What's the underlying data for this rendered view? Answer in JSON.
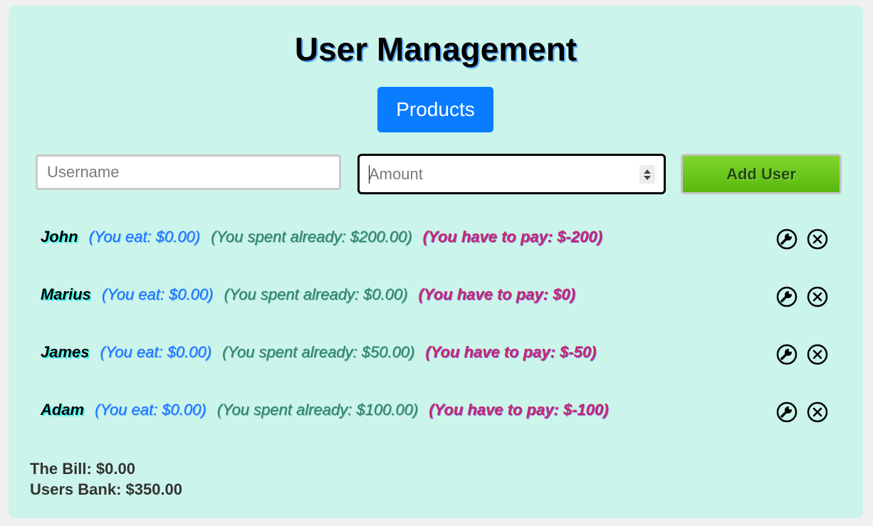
{
  "header": {
    "title": "User Management",
    "products_label": "Products"
  },
  "form": {
    "username_placeholder": "Username",
    "username_value": "",
    "amount_placeholder": "Amount",
    "amount_value": "",
    "add_label": "Add User"
  },
  "users": [
    {
      "name": "John",
      "eat": "(You eat: $0.00)",
      "spent": "(You spent already: $200.00)",
      "pay": "(You have to pay: $-200)"
    },
    {
      "name": "Marius",
      "eat": "(You eat: $0.00)",
      "spent": "(You spent already: $0.00)",
      "pay": "(You have to pay: $0)"
    },
    {
      "name": "James",
      "eat": "(You eat: $0.00)",
      "spent": "(You spent already: $50.00)",
      "pay": "(You have to pay: $-50)"
    },
    {
      "name": "Adam",
      "eat": "(You eat: $0.00)",
      "spent": "(You spent already: $100.00)",
      "pay": "(You have to pay: $-100)"
    }
  ],
  "icons": {
    "edit": "wrench-icon",
    "delete": "close-circle-icon"
  },
  "summary": {
    "bill": "The Bill: $0.00",
    "bank": "Users Bank: $350.00"
  },
  "colors": {
    "background": "#cbf4ea",
    "products_button": "#0a7cff",
    "add_button": "#5ab80f",
    "eat_text": "#1673ff",
    "spent_text": "#2f7f6a",
    "pay_text": "#c42a6a"
  }
}
